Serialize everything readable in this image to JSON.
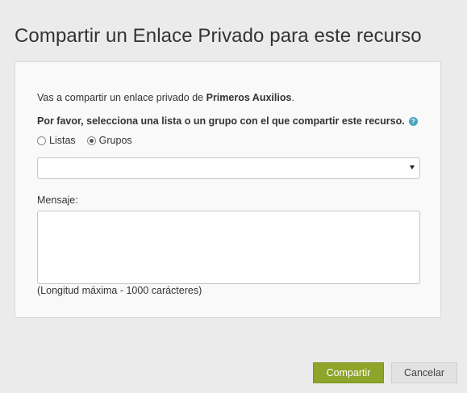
{
  "dialog": {
    "title": "Compartir un Enlace Privado para este recurso"
  },
  "form": {
    "intro_prefix": "Vas a compartir un enlace privado de ",
    "resource_name": "Primeros Auxilios",
    "intro_suffix": ".",
    "prompt": "Por favor, selecciona una lista o un grupo con el que compartir este recurso.",
    "help_icon": "?",
    "radio_options": [
      {
        "label": "Listas",
        "checked": false
      },
      {
        "label": "Grupos",
        "checked": true
      }
    ],
    "select": {
      "value": ""
    },
    "message_label": "Mensaje:",
    "message_value": "",
    "hint": "(Longitud máxima - 1000 carácteres)"
  },
  "actions": {
    "share_label": "Compartir",
    "cancel_label": "Cancelar"
  },
  "colors": {
    "primary_button": "#8ea42a",
    "background": "#ebebeb",
    "panel": "#f9f9f9",
    "help_icon": "#4aa3bf"
  }
}
